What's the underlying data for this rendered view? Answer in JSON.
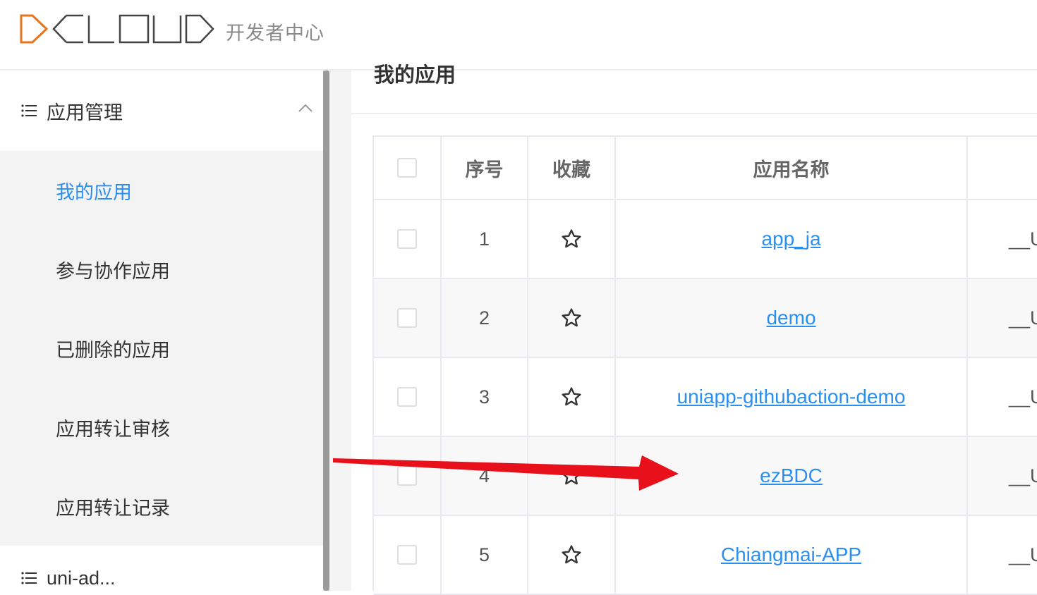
{
  "header": {
    "logo_text": "DCLOUD",
    "subtitle": "开发者中心"
  },
  "sidebar": {
    "group1_label": "应用管理",
    "items": [
      {
        "label": "我的应用",
        "active": true
      },
      {
        "label": "参与协作应用",
        "active": false
      },
      {
        "label": "已删除的应用",
        "active": false
      },
      {
        "label": "应用转让审核",
        "active": false
      },
      {
        "label": "应用转让记录",
        "active": false
      }
    ],
    "group2_label": "uni-ad..."
  },
  "main": {
    "title": "我的应用",
    "table": {
      "columns": [
        "序号",
        "收藏",
        "应用名称"
      ],
      "rows": [
        {
          "index": "1",
          "name": "app_ja",
          "extra": "__U"
        },
        {
          "index": "2",
          "name": "demo",
          "extra": "__U"
        },
        {
          "index": "3",
          "name": "uniapp-githubaction-demo",
          "extra": "__U"
        },
        {
          "index": "4",
          "name": "ezBDC",
          "extra": "__U"
        },
        {
          "index": "5",
          "name": "Chiangmai-APP",
          "extra": "__U"
        }
      ]
    }
  },
  "colors": {
    "accent": "#2b8ff0",
    "logo_orange": "#e8741e",
    "annotation_arrow": "#e8101a"
  },
  "icons": {
    "menu": "list-icon",
    "collapse": "chevron-up-icon",
    "favorite": "star-outline-icon"
  }
}
